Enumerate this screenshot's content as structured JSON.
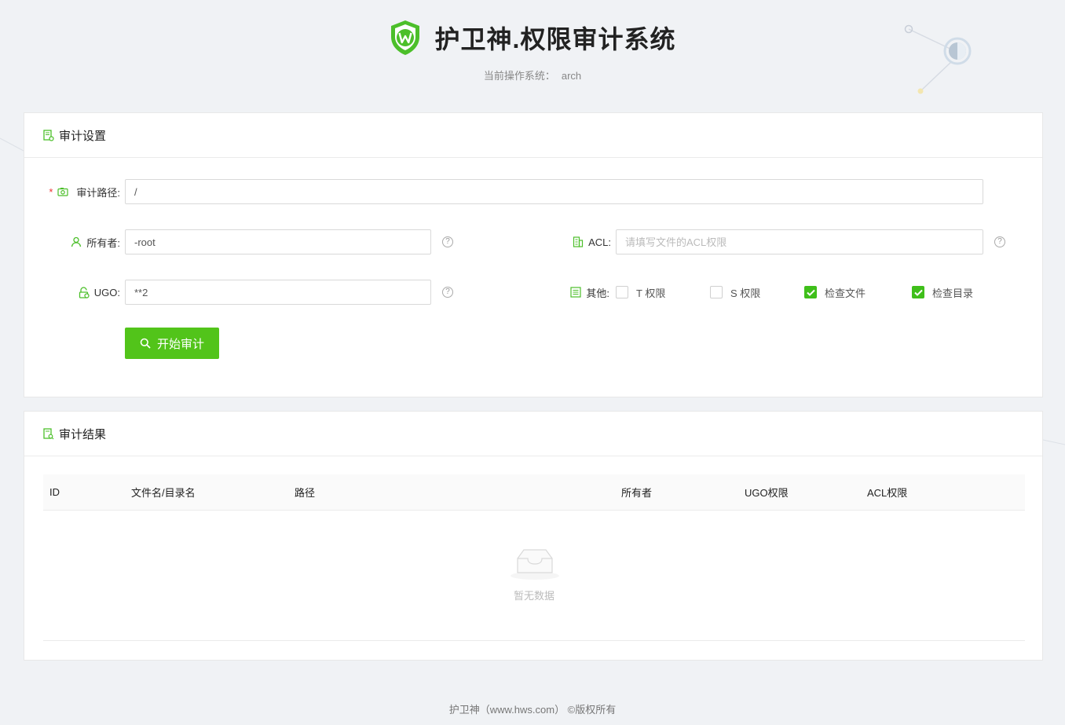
{
  "header": {
    "title": "护卫神.权限审计系统",
    "os_label": "当前操作系统：",
    "os_value": "arch"
  },
  "settings": {
    "title": "审计设置",
    "path_label": "审计路径:",
    "path_value": "/",
    "owner_label": "所有者:",
    "owner_value": "-root",
    "acl_label": "ACL:",
    "acl_placeholder": "请填写文件的ACL权限",
    "ugo_label": "UGO:",
    "ugo_value": "**2",
    "other_label": "其他:",
    "options": [
      {
        "label": "T 权限",
        "checked": false
      },
      {
        "label": "S 权限",
        "checked": false
      },
      {
        "label": "检查文件",
        "checked": true
      },
      {
        "label": "检查目录",
        "checked": true
      }
    ],
    "start_button": "开始审计",
    "required_mark": "*",
    "help_mark": "?"
  },
  "results": {
    "title": "审计结果",
    "columns": [
      "ID",
      "文件名/目录名",
      "路径",
      "所有者",
      "UGO权限",
      "ACL权限"
    ],
    "empty_text": "暂无数据"
  },
  "footer": {
    "text": "护卫神（www.hws.com） ©版权所有"
  },
  "colors": {
    "accent": "#52c41a",
    "checked": "#3fbf1a",
    "background": "#f0f2f5"
  }
}
